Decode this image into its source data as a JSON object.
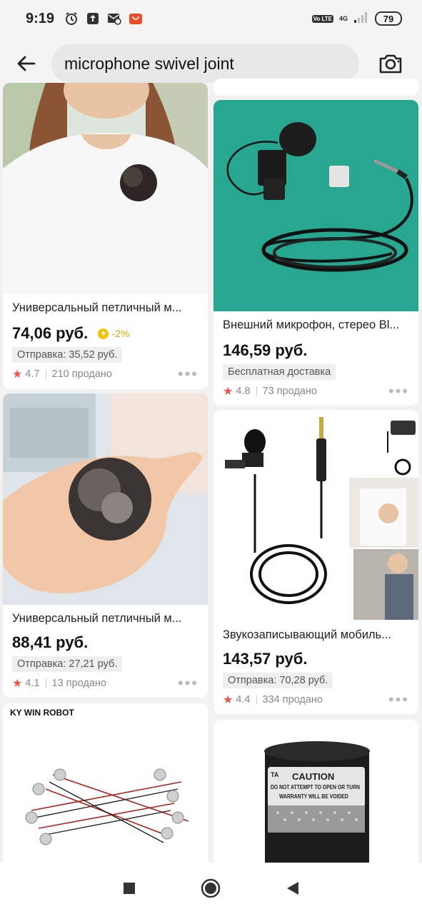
{
  "status": {
    "time": "9:19",
    "network": "4G",
    "volte": "Vo LTE",
    "battery": "79",
    "icons": [
      "alarm-icon",
      "upload-icon",
      "message-icon",
      "aliexpress-icon"
    ]
  },
  "search": {
    "query": "microphone swivel joint",
    "back_icon": "arrow-left-icon",
    "camera_icon": "camera-icon"
  },
  "products_left": [
    {
      "title": "Универсальный петличный м...",
      "price": "74,06 руб.",
      "discount": "-2%",
      "shipping": "Отправка: 35,52 руб.",
      "rating": "4.7",
      "sold": "210 продано"
    },
    {
      "title": "Универсальный петличный м...",
      "price": "88,41 руб.",
      "shipping": "Отправка: 27,21 руб.",
      "rating": "4.1",
      "sold": "13 продано"
    },
    {
      "brand": "KY WIN ROBOT"
    }
  ],
  "products_right": [
    {
      "title": "Внешний микрофон, стерео Bl...",
      "price": "146,59 руб.",
      "shipping": "Бесплатная доставка",
      "rating": "4.8",
      "sold": "73 продано"
    },
    {
      "title": "Звукозаписывающий мобиль...",
      "price": "143,57 руб.",
      "shipping": "Отправка: 70,28 руб.",
      "rating": "4.4",
      "sold": "334 продано"
    },
    {
      "caution_title": "CAUTION",
      "caution_line1": "DO NOT ATTEMPT TO OPEN OR TURN",
      "caution_line2": "WARRANTY WILL BE VOIDED",
      "caution_ta": "TA"
    }
  ],
  "nav": {
    "recents": "square-icon",
    "home": "circle-icon",
    "back": "triangle-back-icon"
  }
}
